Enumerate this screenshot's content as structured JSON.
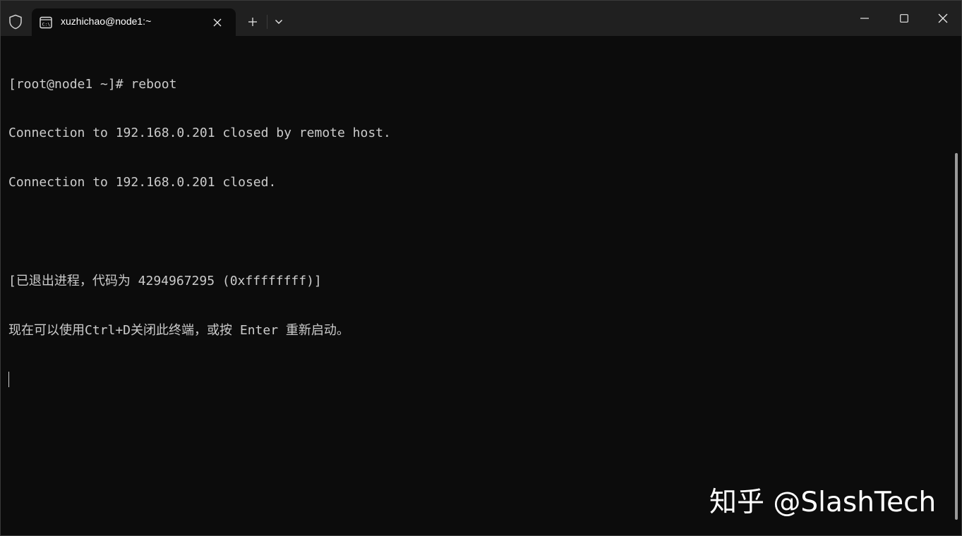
{
  "window": {
    "tab_title": "xuzhichao@node1:~",
    "icons": {
      "shield": "shield-icon",
      "tab": "terminal-icon",
      "close_tab": "close-icon",
      "new_tab": "plus-icon",
      "dropdown": "chevron-down-icon",
      "minimize": "minimize-icon",
      "maximize": "maximize-icon",
      "close_window": "close-icon"
    }
  },
  "terminal": {
    "lines": [
      "[root@node1 ~]# reboot",
      "Connection to 192.168.0.201 closed by remote host.",
      "Connection to 192.168.0.201 closed.",
      "",
      "[已退出进程，代码为 4294967295 (0xffffffff)]",
      "现在可以使用Ctrl+D关闭此终端，或按 Enter 重新启动。"
    ]
  },
  "watermark": "知乎 @SlashTech",
  "colors": {
    "titlebar": "#202020",
    "terminal_bg": "#0c0c0c",
    "terminal_fg": "#cccccc"
  }
}
